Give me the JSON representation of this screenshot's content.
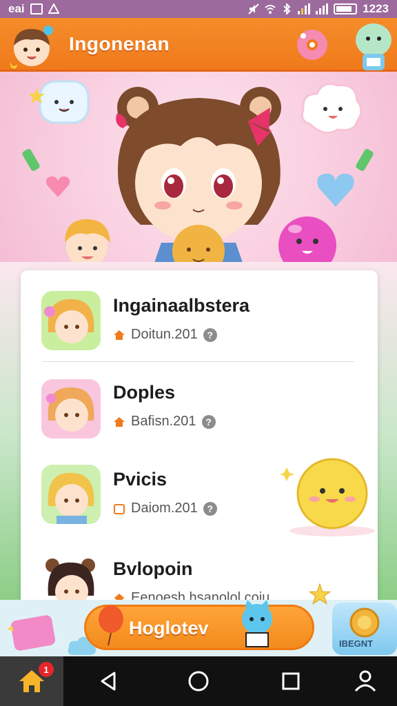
{
  "status_bar": {
    "left_text": "eai",
    "time": "1223"
  },
  "header": {
    "title": "Ingonenan"
  },
  "list": {
    "items": [
      {
        "title": "Ingainaalbstera",
        "meta": "Doitun.201"
      },
      {
        "title": "Doples",
        "meta": "Bafisn.201"
      },
      {
        "title": "Pvicis",
        "meta": "Daiom.201"
      },
      {
        "title": "Bvlopoin",
        "meta": "Eenoesh hsanolol coiu"
      }
    ],
    "info_glyph": "?"
  },
  "bottom": {
    "button_label": "Hoglotev",
    "badge_label": "IBEGNT"
  },
  "nav": {
    "home_badge": "1"
  },
  "colors": {
    "header_orange": "#f07a1c",
    "status_purple": "#9c6a9c",
    "nav_black": "#111111",
    "badge_red": "#e6262a"
  },
  "icons": [
    "home-icon",
    "back-icon",
    "circle-home-icon",
    "recents-icon",
    "account-icon",
    "info-icon",
    "house-icon"
  ]
}
